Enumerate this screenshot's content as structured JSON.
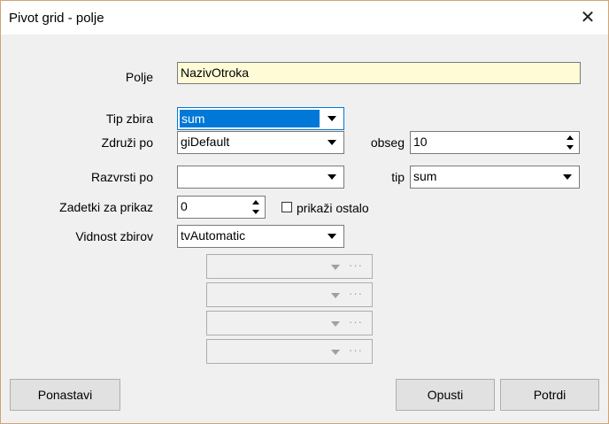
{
  "window": {
    "title": "Pivot grid - polje",
    "close_glyph": "✕"
  },
  "fields": {
    "polje": {
      "label": "Polje",
      "value": "NazivOtroka"
    },
    "tip_zbira": {
      "label": "Tip zbira",
      "value": "sum"
    },
    "zdruzi_po": {
      "label": "Združi po",
      "value": "giDefault"
    },
    "obseg": {
      "label": "obseg",
      "value": "10"
    },
    "razvrsti_po": {
      "label": "Razvrsti po",
      "value": ""
    },
    "tip": {
      "label": "tip",
      "value": "sum"
    },
    "zadetki": {
      "label": "Zadetki za prikaz",
      "value": "0"
    },
    "prikazi_ostalo": {
      "label": "prikaži ostalo",
      "checked": false
    },
    "vidnost": {
      "label": "Vidnost zbirov",
      "value": "tvAutomatic"
    }
  },
  "disabled_combos": [
    {
      "dots": "···"
    },
    {
      "dots": "···"
    },
    {
      "dots": "···"
    },
    {
      "dots": "···"
    }
  ],
  "buttons": {
    "reset": "Ponastavi",
    "cancel": "Opusti",
    "ok": "Potrdi"
  },
  "colors": {
    "selection": "#0078d7",
    "highlight_field": "#fffbd6",
    "dialog_bg": "#f0f0f0"
  },
  "icons": [
    "close-icon",
    "chevron-down-icon",
    "spin-up-icon",
    "spin-down-icon",
    "ellipsis-icon"
  ]
}
